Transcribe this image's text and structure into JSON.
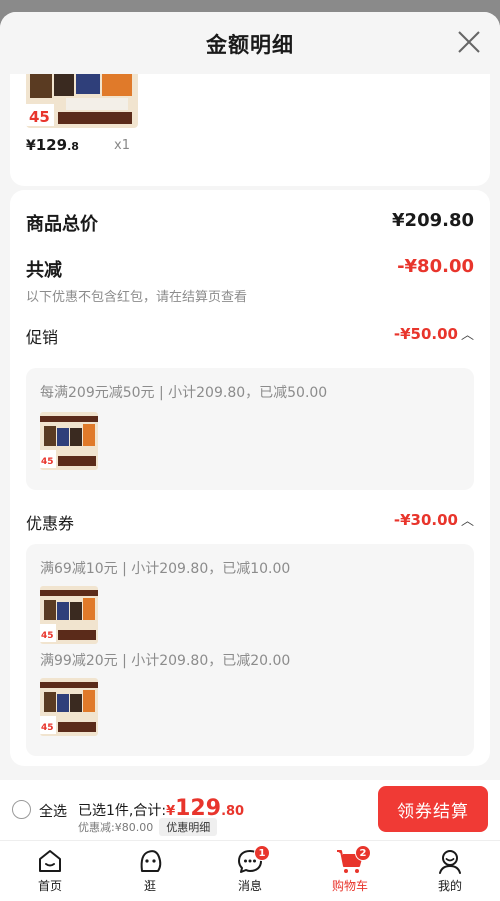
{
  "header": {
    "title": "金额明细"
  },
  "product": {
    "badge_text": "45",
    "price_yen": "¥",
    "price_int": "129",
    "price_dec": ".8",
    "qty": "x1"
  },
  "summary": {
    "total_label": "商品总价",
    "total_value": "¥209.80",
    "reduce_label": "共减",
    "reduce_value": "-¥80.00",
    "reduce_note": "以下优惠不包含红包，请在结算页查看",
    "promo": {
      "label": "促销",
      "value": "-¥50.00",
      "lines": [
        "每满209元减50元 | 小计209.80，已减50.00"
      ]
    },
    "coupon": {
      "label": "优惠券",
      "value": "-¥30.00",
      "lines": [
        "满69减10元 | 小计209.80，已减10.00",
        "满99减20元 | 小计209.80，已减20.00"
      ]
    }
  },
  "checkout": {
    "select_all": "全选",
    "selected_prefix": "已选1件,合计:",
    "amount_yen": "¥",
    "amount_int": "129",
    "amount_dec": ".80",
    "discount": "优惠减:¥80.00",
    "detail_button": "优惠明细",
    "pay_button": "领券结算"
  },
  "tabs": [
    {
      "label": "首页",
      "icon": "home-icon"
    },
    {
      "label": "逛",
      "icon": "face-icon"
    },
    {
      "label": "消息",
      "icon": "message-icon",
      "badge": "1"
    },
    {
      "label": "购物车",
      "icon": "cart-icon",
      "badge": "2"
    },
    {
      "label": "我的",
      "icon": "profile-icon"
    }
  ],
  "colors": {
    "accent": "#e8352c",
    "button": "#f03a35",
    "background": "#f5f5f5"
  }
}
